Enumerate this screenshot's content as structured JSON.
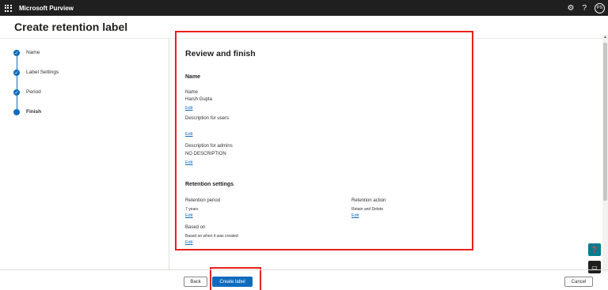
{
  "app": {
    "name": "Microsoft Purview",
    "avatar_initials": "PS",
    "settings_icon": "gear-icon",
    "help_icon": "question-icon",
    "help_glyph": "?"
  },
  "page": {
    "title": "Create retention label"
  },
  "wizard": {
    "steps": [
      {
        "label": "Name",
        "state": "completed"
      },
      {
        "label": "Label Settings",
        "state": "completed"
      },
      {
        "label": "Period",
        "state": "completed"
      },
      {
        "label": "Finish",
        "state": "current"
      }
    ]
  },
  "review": {
    "heading": "Review and finish",
    "name_section": {
      "heading": "Name",
      "name_label": "Name",
      "name_value": "Harsh Gupta",
      "edit_1": "Edit",
      "desc_users_label": "Description for users",
      "desc_users_value": "",
      "edit_2": "Edit",
      "desc_admins_label": "Description for admins",
      "desc_admins_value": "NO DESCRIPTION",
      "edit_3": "Edit"
    },
    "retention_section": {
      "heading": "Retention settings",
      "period_label": "Retention period",
      "period_value": "7 years",
      "edit_period": "Edit",
      "action_label": "Retention action",
      "action_value": "Retain and Delete",
      "edit_action": "Edit",
      "based_on_label": "Based on",
      "based_on_value": "Based on when it was created",
      "edit_based_on": "Edit"
    }
  },
  "footer": {
    "back": "Back",
    "create": "Create label",
    "cancel": "Cancel"
  },
  "colors": {
    "accent": "#0f6cbd",
    "highlight": "#e8211b",
    "topbar": "#1f1f1f",
    "teal": "#037c8c"
  }
}
